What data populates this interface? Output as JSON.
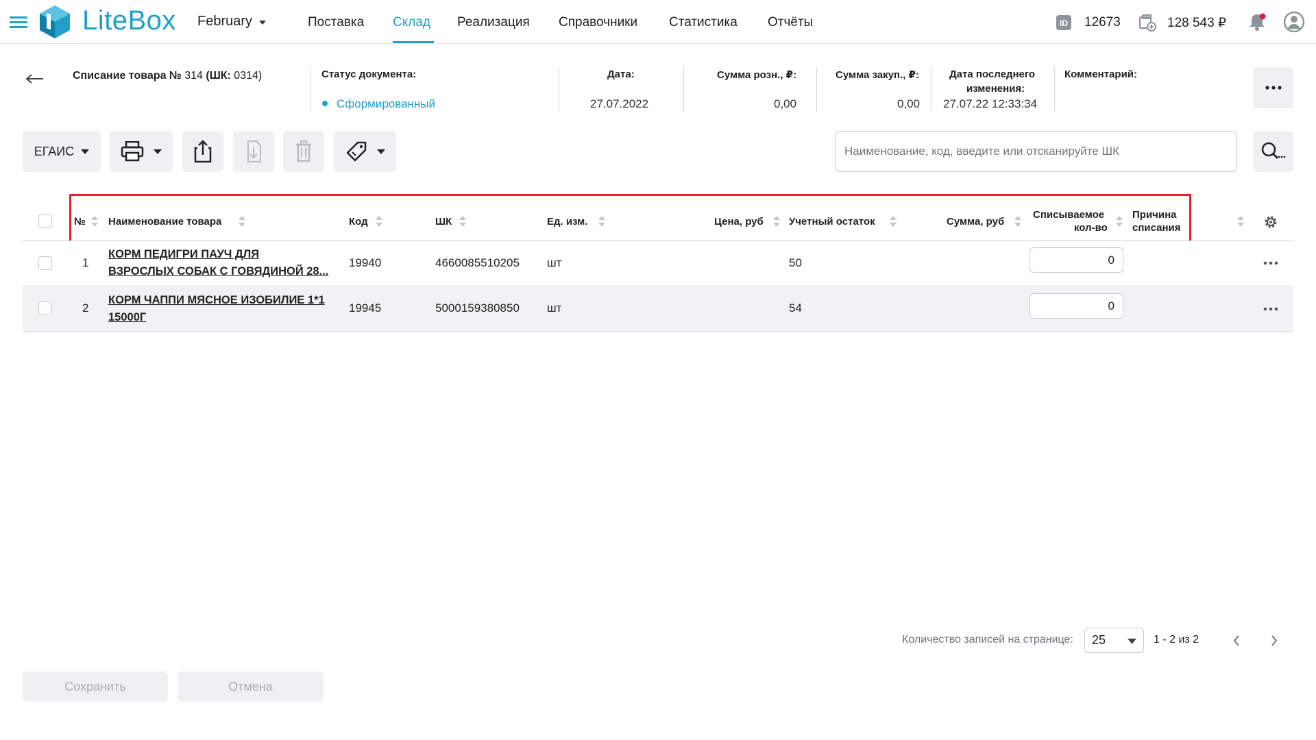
{
  "app": {
    "brand": "LiteBox",
    "month": "February",
    "accent": "#1ea0c8"
  },
  "nav": {
    "items": [
      {
        "label": "Поставка"
      },
      {
        "label": "Склад"
      },
      {
        "label": "Реализация"
      },
      {
        "label": "Справочники"
      },
      {
        "label": "Статистика"
      },
      {
        "label": "Отчёты"
      }
    ],
    "active_index": 1
  },
  "account": {
    "id": "12673",
    "balance": "128 543 ₽"
  },
  "document": {
    "title_bold": "Списание товара №",
    "title_num": " 314 ",
    "title_bold2": "(ШК:",
    "title_num2": " 0314)",
    "status_label": "Статус документа:",
    "status_value": "Сформированный",
    "date_label": "Дата:",
    "date_value": "27.07.2022",
    "retail_label": "Сумма розн., ₽:",
    "retail_value": "0,00",
    "purchase_label": "Сумма закуп., ₽:",
    "purchase_value": "0,00",
    "changed_label_1": "Дата последнего",
    "changed_label_2": "изменения:",
    "changed_value": "27.07.22 12:33:34",
    "comment_label": "Комментарий:"
  },
  "toolbar": {
    "egais_label": "ЕГАИС",
    "search_placeholder": "Наименование, код, введите или отсканируйте ШК"
  },
  "table": {
    "headers": {
      "num": "№",
      "name": "Наименование товара",
      "code": "Код",
      "barcode": "ШК",
      "unit": "Ед. изм.",
      "price": "Цена, руб",
      "stock": "Учетный остаток",
      "sum": "Сумма, руб",
      "qty_1": "Списываемое",
      "qty_2": "кол-во",
      "reason_1": "Причина",
      "reason_2": "списания"
    },
    "rows": [
      {
        "num": "1",
        "name_1": "КОРМ ПЕДИГРИ ПАУЧ ДЛЯ",
        "name_2": "ВЗРОСЛЫХ СОБАК С ГОВЯДИНОЙ 28...",
        "code": "19940",
        "barcode": "4660085510205",
        "unit": "шт",
        "stock": "50",
        "qty": "0"
      },
      {
        "num": "2",
        "name_1": "КОРМ ЧАППИ МЯСНОЕ ИЗОБИЛИЕ 1*1",
        "name_2": "15000Г",
        "code": "19945",
        "barcode": "5000159380850",
        "unit": "шт",
        "stock": "54",
        "qty": "0"
      }
    ]
  },
  "pagination": {
    "label": "Количество записей на странице:",
    "page_size": "25",
    "range": "1 - 2 из 2"
  },
  "footer": {
    "save_label": "Сохранить",
    "cancel_label": "Отмена"
  }
}
